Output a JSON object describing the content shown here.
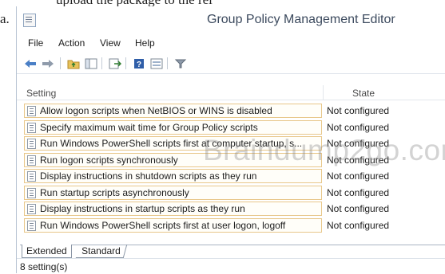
{
  "window": {
    "title": "Group Policy Management Editor"
  },
  "fragments": {
    "top_text": "upload the package to the rel",
    "left_label": "a."
  },
  "menubar": [
    {
      "label": "File"
    },
    {
      "label": "Action"
    },
    {
      "label": "View"
    },
    {
      "label": "Help"
    }
  ],
  "toolbar": {
    "buttons": [
      "back-arrow-icon",
      "forward-arrow-icon",
      "up-folder-icon",
      "show-hide-tree-icon",
      "export-list-icon",
      "help-icon",
      "properties-icon",
      "filter-icon"
    ]
  },
  "list": {
    "headers": {
      "setting": "Setting",
      "state": "State"
    },
    "rows": [
      {
        "setting": "Allow logon scripts when NetBIOS or WINS is disabled",
        "state": "Not configured"
      },
      {
        "setting": "Specify maximum wait time for Group Policy scripts",
        "state": "Not configured"
      },
      {
        "setting": "Run Windows PowerShell scripts first at computer startup, s...",
        "state": "Not configured"
      },
      {
        "setting": "Run logon scripts synchronously",
        "state": "Not configured"
      },
      {
        "setting": "Display instructions in shutdown scripts as they run",
        "state": "Not configured"
      },
      {
        "setting": "Run startup scripts asynchronously",
        "state": "Not configured"
      },
      {
        "setting": "Display instructions in startup scripts as they run",
        "state": "Not configured"
      },
      {
        "setting": "Run Windows PowerShell scripts first at user logon, logoff",
        "state": "Not configured"
      }
    ]
  },
  "watermark": "Braindump2go.com",
  "tabs": [
    {
      "label": "Extended",
      "selected": true
    },
    {
      "label": "Standard",
      "selected": false
    }
  ],
  "status": {
    "text": "8 setting(s)"
  },
  "colors": {
    "row_border": "#e8c78a",
    "title_text": "#3c4a5e",
    "back_arrow": "#4a7fc6",
    "forward_arrow": "#4a7fc6"
  }
}
